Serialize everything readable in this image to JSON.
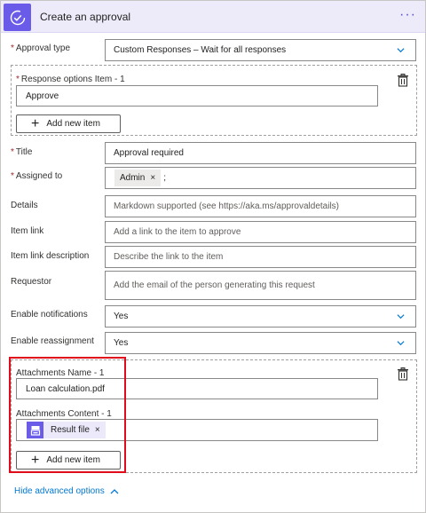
{
  "header": {
    "title": "Create an approval",
    "more_label": "···"
  },
  "approval_type": {
    "label": "Approval type",
    "value": "Custom Responses – Wait for all responses"
  },
  "response_options": {
    "label": "Response options Item - 1",
    "value": "Approve",
    "add_label": "Add new item"
  },
  "title_field": {
    "label": "Title",
    "value": "Approval required"
  },
  "assigned_to": {
    "label": "Assigned to",
    "token": "Admin",
    "token_remove": "×",
    "separator": ";"
  },
  "details": {
    "label": "Details",
    "placeholder": "Markdown supported (see https://aka.ms/approvaldetails)"
  },
  "item_link": {
    "label": "Item link",
    "placeholder": "Add a link to the item to approve"
  },
  "item_link_description": {
    "label": "Item link description",
    "placeholder": "Describe the link to the item"
  },
  "requestor": {
    "label": "Requestor",
    "placeholder": "Add the email of the person generating this request"
  },
  "enable_notifications": {
    "label": "Enable notifications",
    "value": "Yes"
  },
  "enable_reassignment": {
    "label": "Enable reassignment",
    "value": "Yes"
  },
  "attachments": {
    "name_label": "Attachments Name - 1",
    "name_value": "Loan calculation.pdf",
    "content_label": "Attachments Content - 1",
    "content_token": "Result file",
    "content_token_remove": "×",
    "add_label": "Add new item"
  },
  "footer": {
    "advanced_label": "Hide advanced options"
  },
  "colors": {
    "accent": "#6a5ce8",
    "header_bg": "#edebf9",
    "link": "#0078d4",
    "required": "#a4262c",
    "highlight": "#e00c1c"
  }
}
